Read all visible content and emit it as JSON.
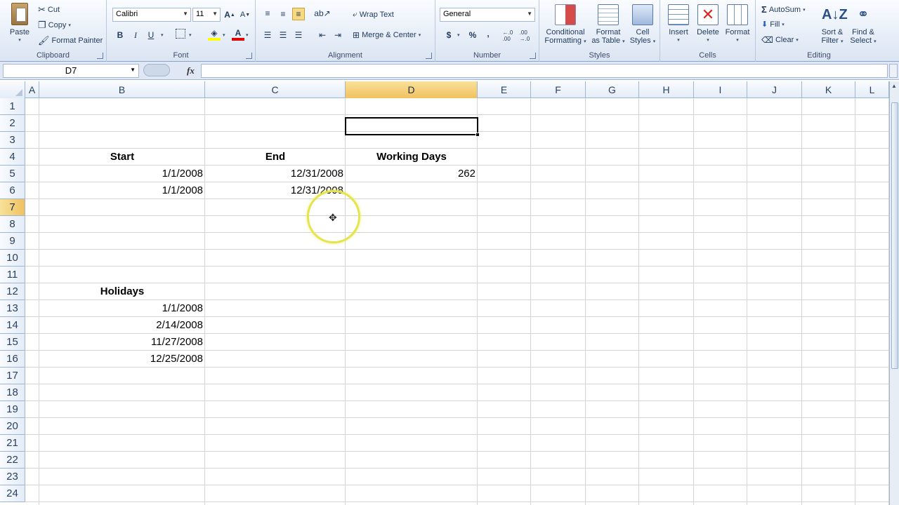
{
  "ribbon": {
    "clipboard": {
      "label": "Clipboard",
      "paste": "Paste",
      "cut": "Cut",
      "copy": "Copy",
      "format_painter": "Format Painter"
    },
    "font": {
      "label": "Font",
      "font_name": "Calibri",
      "font_size": "11",
      "bold": "B",
      "italic": "I",
      "underline": "U"
    },
    "alignment": {
      "label": "Alignment",
      "wrap_text": "Wrap Text",
      "merge_center": "Merge & Center"
    },
    "number": {
      "label": "Number",
      "format": "General",
      "currency": "$",
      "percent": "%",
      "comma": ","
    },
    "styles": {
      "label": "Styles",
      "conditional_formatting_1": "Conditional",
      "conditional_formatting_2": "Formatting",
      "format_as_table_1": "Format",
      "format_as_table_2": "as Table",
      "cell_styles_1": "Cell",
      "cell_styles_2": "Styles"
    },
    "cells": {
      "label": "Cells",
      "insert": "Insert",
      "delete": "Delete",
      "format": "Format"
    },
    "editing": {
      "label": "Editing",
      "autosum": "AutoSum",
      "fill": "Fill",
      "clear": "Clear",
      "sort_filter_1": "Sort &",
      "sort_filter_2": "Filter",
      "find_select_1": "Find &",
      "find_select_2": "Select"
    }
  },
  "formula_bar": {
    "name_box": "D7",
    "fx": "fx",
    "formula": ""
  },
  "columns": [
    "A",
    "B",
    "C",
    "D",
    "E",
    "F",
    "G",
    "H",
    "I",
    "J",
    "K",
    "L"
  ],
  "selected_column": "D",
  "rows": [
    "1",
    "2",
    "3",
    "4",
    "5",
    "6",
    "7",
    "8",
    "9",
    "10",
    "11",
    "12",
    "13",
    "14",
    "15",
    "16",
    "17",
    "18",
    "19",
    "20",
    "21",
    "22",
    "23",
    "24"
  ],
  "selected_row": "7",
  "cells": {
    "B4": "Start",
    "C4": "End",
    "D4": "Working Days",
    "B5": "1/1/2008",
    "C5": "12/31/2008",
    "D5": "262",
    "B6": "1/1/2008",
    "C6": "12/31/2008",
    "B12": "Holidays",
    "B13": "1/1/2008",
    "B14": "2/14/2008",
    "B15": "11/27/2008",
    "B16": "12/25/2008"
  },
  "colors": {
    "selection_header": "#f1c15f",
    "grid_line": "#d4d4d4",
    "cursor_highlight": "#e4e44f"
  }
}
